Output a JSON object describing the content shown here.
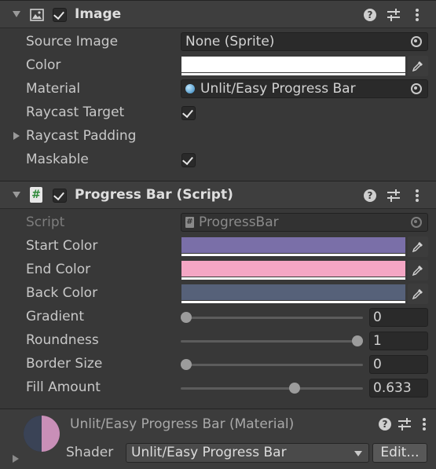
{
  "image_component": {
    "title": "Image",
    "enabled": true,
    "icon": "image-component-icon",
    "fields": {
      "source_image": {
        "label": "Source Image",
        "value": "None (Sprite)"
      },
      "color": {
        "label": "Color",
        "value": "#ffffff"
      },
      "material": {
        "label": "Material",
        "value": "Unlit/Easy Progress Bar"
      },
      "raycast_target": {
        "label": "Raycast Target",
        "checked": true
      },
      "raycast_padding": {
        "label": "Raycast Padding"
      },
      "maskable": {
        "label": "Maskable",
        "checked": true
      }
    }
  },
  "progress_bar_component": {
    "title": "Progress Bar (Script)",
    "enabled": true,
    "icon": "script-hash-icon",
    "fields": {
      "script": {
        "label": "Script",
        "value": "ProgressBar"
      },
      "start_color": {
        "label": "Start Color",
        "value": "#7a6fa8"
      },
      "end_color": {
        "label": "End Color",
        "value": "#f4a6c4"
      },
      "back_color": {
        "label": "Back Color",
        "value": "#566179"
      },
      "gradient": {
        "label": "Gradient",
        "value": "0",
        "fraction": 0
      },
      "roundness": {
        "label": "Roundness",
        "value": "1",
        "fraction": 1
      },
      "border_size": {
        "label": "Border Size",
        "value": "0",
        "fraction": 0
      },
      "fill_amount": {
        "label": "Fill Amount",
        "value": "0.633",
        "fraction": 0.633
      }
    }
  },
  "material_footer": {
    "title": "Unlit/Easy Progress Bar (Material)",
    "shader_label": "Shader",
    "shader_value": "Unlit/Easy Progress Bar",
    "edit_label": "Edit..."
  }
}
